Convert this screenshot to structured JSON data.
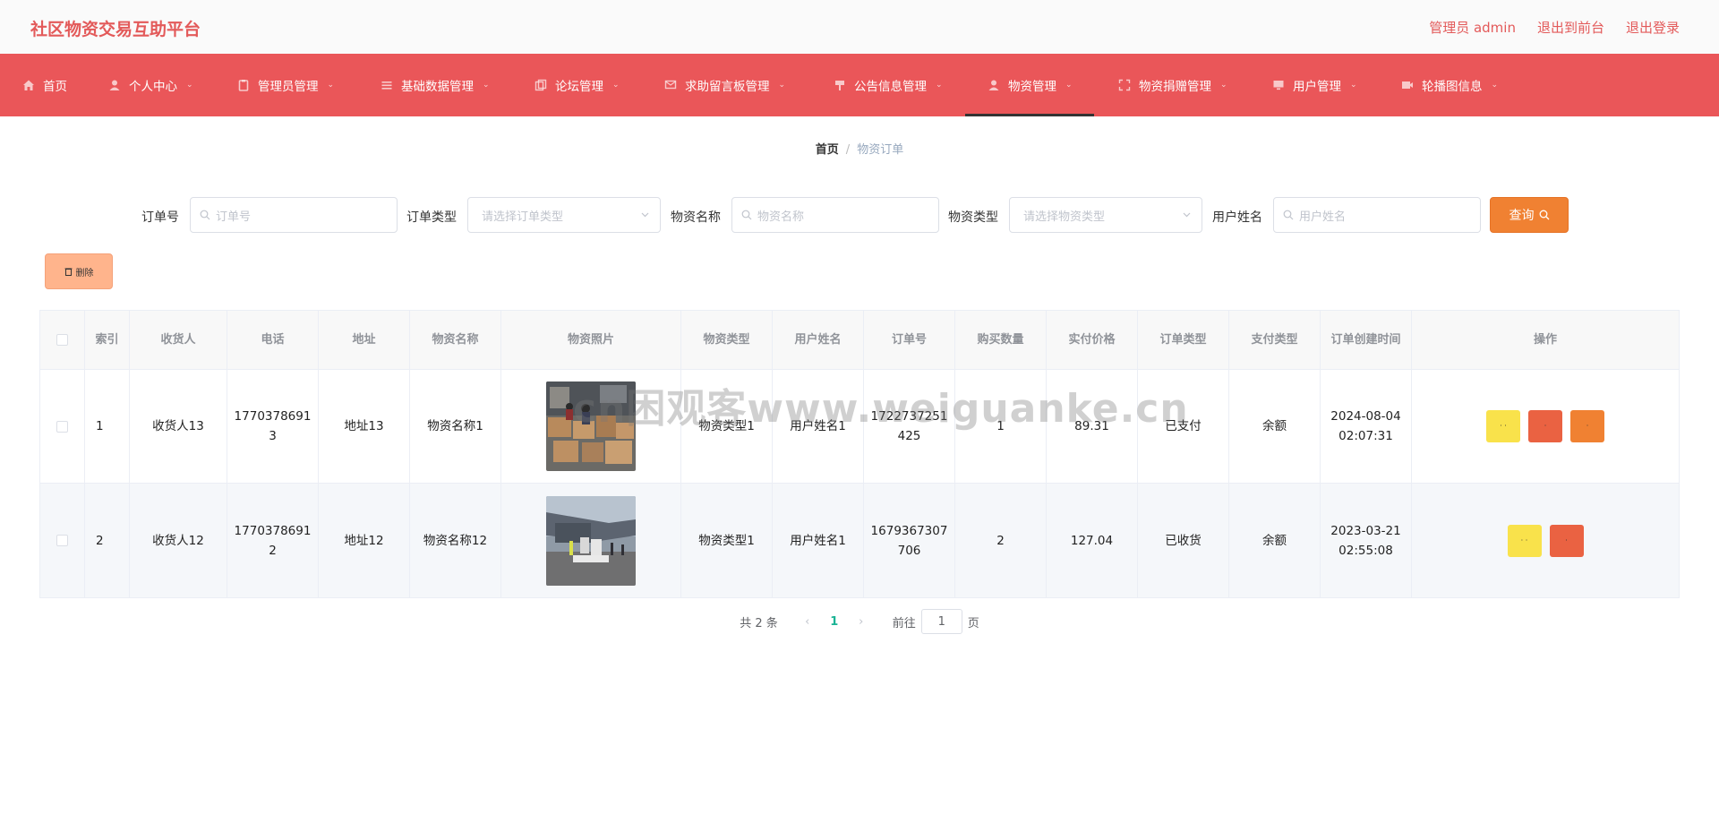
{
  "header": {
    "title": "社区物资交易互助平台",
    "links": [
      "管理员 admin",
      "退出到前台",
      "退出登录"
    ]
  },
  "nav": {
    "items": [
      {
        "label": "首页",
        "icon": "home-icon"
      },
      {
        "label": "个人中心",
        "icon": "user-icon"
      },
      {
        "label": "管理员管理",
        "icon": "clipboard-icon"
      },
      {
        "label": "基础数据管理",
        "icon": "list-icon"
      },
      {
        "label": "论坛管理",
        "icon": "copy-icon"
      },
      {
        "label": "求助留言板管理",
        "icon": "message-icon"
      },
      {
        "label": "公告信息管理",
        "icon": "announcement-icon"
      },
      {
        "label": "物资管理",
        "icon": "person-icon"
      },
      {
        "label": "物资捐赠管理",
        "icon": "fullscreen-icon"
      },
      {
        "label": "用户管理",
        "icon": "monitor-icon"
      },
      {
        "label": "轮播图信息",
        "icon": "video-icon"
      }
    ],
    "active_index": 7
  },
  "breadcrumb": {
    "home": "首页",
    "separator": "/",
    "current": "物资订单"
  },
  "search": {
    "order_no": {
      "label": "订单号",
      "placeholder": "订单号"
    },
    "order_type": {
      "label": "订单类型",
      "placeholder": "请选择订单类型"
    },
    "goods_name": {
      "label": "物资名称",
      "placeholder": "物资名称"
    },
    "goods_type": {
      "label": "物资类型",
      "placeholder": "请选择物资类型"
    },
    "user_name": {
      "label": "用户姓名",
      "placeholder": "用户姓名"
    },
    "query_label": "查询"
  },
  "delete_label": "删除",
  "table": {
    "columns": [
      "索引",
      "收货人",
      "电话",
      "地址",
      "物资名称",
      "物资照片",
      "物资类型",
      "用户姓名",
      "订单号",
      "购买数量",
      "实付价格",
      "订单类型",
      "支付类型",
      "订单创建时间",
      "操作"
    ],
    "rows": [
      {
        "index": "1",
        "receiver": "收货人13",
        "phone": "17703786913",
        "address": "地址13",
        "goods_name": "物资名称1",
        "photo": "warehouse-boxes",
        "goods_type": "物资类型1",
        "user_name": "用户姓名1",
        "order_no": "1722737251425",
        "quantity": "1",
        "price": "89.31",
        "order_type": "已支付",
        "pay_type": "余额",
        "created": "2024-08-04 02:07:31",
        "actions": [
          "yellow",
          "red",
          "orange"
        ]
      },
      {
        "index": "2",
        "receiver": "收货人12",
        "phone": "17703786912",
        "address": "地址12",
        "goods_name": "物资名称12",
        "photo": "cargo-plane",
        "goods_type": "物资类型1",
        "user_name": "用户姓名1",
        "order_no": "1679367307706",
        "quantity": "2",
        "price": "127.04",
        "order_type": "已收货",
        "pay_type": "余额",
        "created": "2023-03-21 02:55:08",
        "actions": [
          "yellow",
          "red"
        ]
      }
    ]
  },
  "pagination": {
    "total": "共 2 条",
    "current": "1",
    "goto_label": "前往",
    "page_value": "1",
    "page_unit": "页"
  },
  "watermark": "cn困观客www.weiguanke.cn",
  "colors": {
    "accent": "#ea5659",
    "brand_text": "#e35a5a",
    "query": "#f08132",
    "delete": "#ffb48c",
    "active_page": "#1ab394"
  }
}
